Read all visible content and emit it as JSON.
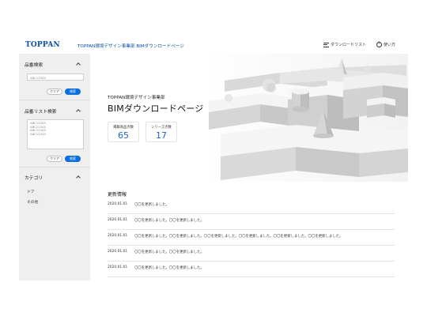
{
  "header": {
    "logo": "TOPPAN",
    "site_title": "TOPPAN環境デザイン事業部 BIMダウンロードページ",
    "download_list_label": "ダウンロードリスト",
    "help_label": "使い方",
    "brand_color": "#0b4ea2"
  },
  "sidebar": {
    "product_search": {
      "title": "品番検索",
      "input_value": "ABC12345",
      "clear_label": "クリア",
      "search_label": "検索"
    },
    "list_search": {
      "title": "品番リスト検索",
      "lines": [
        "ABC12345",
        "ABC12345",
        "ABC12345",
        "ABC12345"
      ],
      "clear_label": "クリア",
      "search_label": "検索"
    },
    "category": {
      "title": "カテゴリ",
      "items": [
        "ドア",
        "その他"
      ]
    }
  },
  "hero": {
    "subtitle": "TOPPAN環境デザイン事業部",
    "title": "BIMダウンロードページ",
    "stats": [
      {
        "label": "掲載商品点数",
        "value": "65"
      },
      {
        "label": "シリーズ点数",
        "value": "17"
      }
    ]
  },
  "news": {
    "title": "更新情報",
    "items": [
      {
        "date": "2020.01.01",
        "text": "〇〇を更新しました。"
      },
      {
        "date": "2020.01.01",
        "text": "〇〇を更新しました。〇〇を更新しました。"
      },
      {
        "date": "2020.01.01",
        "text": "〇〇を更新しました。〇〇を更新しました。〇〇を更新しました。〇〇を更新しました。〇〇を更新しました。〇〇を更新しました。"
      },
      {
        "date": "2020.01.01",
        "text": "〇〇を更新しました。〇〇を更新しました。"
      },
      {
        "date": "2020.01.01",
        "text": "〇〇を更新しました。〇〇を更新しました。"
      }
    ]
  },
  "colors": {
    "accent": "#0b6fe0",
    "stat_number": "#1a66c8",
    "sidebar_bg": "#efefef"
  }
}
